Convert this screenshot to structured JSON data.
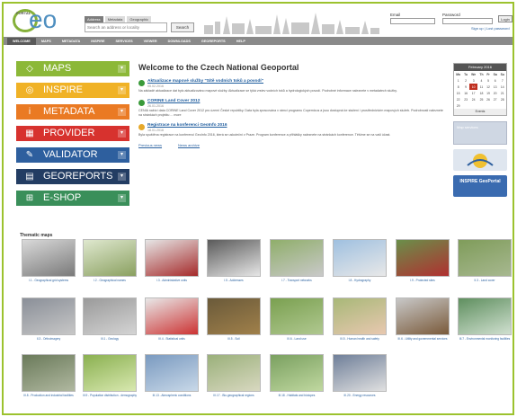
{
  "header": {
    "logo_small": "PORTAL",
    "logo_text": "eo",
    "search_tabs": [
      "Address",
      "Metadata",
      "Geographic"
    ],
    "search_placeholder": "Search an address or locality",
    "search_button": "Search",
    "login": {
      "email_label": "Email",
      "password_label": "Password",
      "login_button": "Login",
      "links": "Sign up | Lost password"
    }
  },
  "nav": [
    "WELCOME",
    "MAPS",
    "METADATA",
    "INSPIRE",
    "SERVICES",
    "VIEWER",
    "DOWNLOADS",
    "GEOREPORTS",
    "HELP"
  ],
  "menu": [
    {
      "label": "MAPS",
      "icon": "map-icon",
      "glyph": "◇",
      "color": "#8cb838"
    },
    {
      "label": "INSPIRE",
      "icon": "inspire-icon",
      "glyph": "◎",
      "color": "#f0b226"
    },
    {
      "label": "METADATA",
      "icon": "info-icon",
      "glyph": "i",
      "color": "#ea7a23"
    },
    {
      "label": "PROVIDER",
      "icon": "provider-icon",
      "glyph": "▦",
      "color": "#d7322e"
    },
    {
      "label": "VALIDATOR",
      "icon": "wrench-icon",
      "glyph": "✎",
      "color": "#2e5f9e"
    },
    {
      "label": "GEOREPORTS",
      "icon": "report-icon",
      "glyph": "▤",
      "color": "#233d63"
    },
    {
      "label": "E-SHOP",
      "icon": "cart-icon",
      "glyph": "⊞",
      "color": "#3a8f5a"
    }
  ],
  "main": {
    "welcome": "Welcome to the Czech National Geoportal",
    "news": [
      {
        "title": "Aktualizace mapové služby \"Sítě vodních toků a povodí\"",
        "date": "05.02.2016",
        "body": "Na základě aktualizace dat bylo aktualizováno mapové služby. Aktualizace se týká vrstev vodních toků a hydrologických povodí. Podrobné informace naleznete v metadatech služby.",
        "color": "#3a9a3a"
      },
      {
        "title": "CORINE Land Cover 2012",
        "date": "26.01.2016",
        "body": "CENIA nabízí data CORINE Land Cover 2012 pro území České republiky. Data byla zpracována v rámci programu Copernicus a jsou dostupná ke stažení i prostřednictvím mapových služeb. Podrobnosti naleznete na stránkách projektu ... more",
        "color": "#3a9a3a"
      },
      {
        "title": "Registrace na konferenci GeoInfo 2016",
        "date": "18.01.2016",
        "body": "Byla spuštěna registrace na konferenci GeoInfo 2016, která se uskuteční v Praze. Program konference a přihlášky naleznete na stránkách konference. Těšíme se na vaši účast.",
        "color": "#e6a82a"
      }
    ],
    "more_links": [
      "Previous news",
      "News archive"
    ]
  },
  "calendar": {
    "header": "February 2016",
    "days": [
      "Mo",
      "Tu",
      "We",
      "Th",
      "Fr",
      "Sa",
      "Su"
    ],
    "rows": [
      [
        "1",
        "2",
        "3",
        "4",
        "5",
        "6",
        "7"
      ],
      [
        "8",
        "9",
        "10",
        "11",
        "12",
        "13",
        "14"
      ],
      [
        "15",
        "16",
        "17",
        "18",
        "19",
        "20",
        "21"
      ],
      [
        "22",
        "23",
        "24",
        "25",
        "26",
        "27",
        "28"
      ],
      [
        "29",
        "",
        "",
        "",
        "",
        "",
        ""
      ]
    ],
    "today": "10",
    "footer": "Events"
  },
  "right_banners": {
    "services": "Map services",
    "inspire": "INSPIRE GeoPortal"
  },
  "thematic": {
    "title": "Thematic maps",
    "items": [
      "I.1 - Geographical grid systems",
      "I.2 - Geographical names",
      "I.3 - Administrative units",
      "I.5 - Addresses",
      "I.7 - Transport networks",
      "I.8 - Hydrography",
      "I.9 - Protected sites",
      "II.3 - Land cover",
      "II.3 - Orthoimagery",
      "III.1 - Geology",
      "III.4 - Statistical units",
      "III.5 - Soil",
      "III.6 - Land use",
      "III.5 - Human health and safety",
      "III.6 - Utility and governmental services",
      "III.7 - Environmental monitoring facilities",
      "III.8 - Production and industrial facilities",
      "III.9 - Population distribution - demography",
      "III.13 - Atmospheric conditions",
      "III.17 - Bio-geographical regions",
      "III.18 - Habitats and biotopes",
      "III.20 - Energy resources"
    ]
  }
}
